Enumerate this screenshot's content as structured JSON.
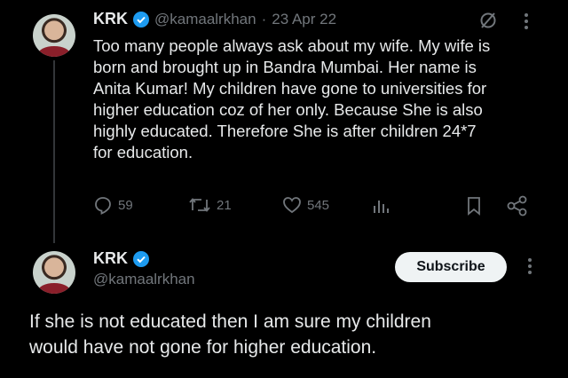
{
  "tweet": {
    "author_name": "KRK",
    "handle": "@kamaalrkhan",
    "separator": "·",
    "date": "23 Apr 22",
    "text_lines": [
      "Too many people always ask about my wife. My wife is",
      "born and brought up in Bandra Mumbai. Her name is",
      "Anita Kumar! My children have gone to universities for",
      "higher education coz of her only. Because She is also",
      "highly educated. Therefore She is after children 24*7",
      "for education."
    ],
    "replies": "59",
    "retweets": "21",
    "likes": "545"
  },
  "reply": {
    "author_name": "KRK",
    "handle": "@kamaalrkhan",
    "subscribe_label": "Subscribe",
    "text_lines": [
      "If she is not educated then I am sure my children",
      "would have not gone for higher education."
    ]
  },
  "icons": {
    "verified": "verified-badge-icon",
    "grok": "grok-icon",
    "more": "more-icon",
    "reply": "reply-icon",
    "retweet": "retweet-icon",
    "like": "like-icon",
    "views": "views-icon",
    "bookmark": "bookmark-icon",
    "share": "share-icon"
  },
  "colors": {
    "background": "#000000",
    "text": "#e7e9ea",
    "muted": "#71767b",
    "verified": "#1d9bf0"
  }
}
